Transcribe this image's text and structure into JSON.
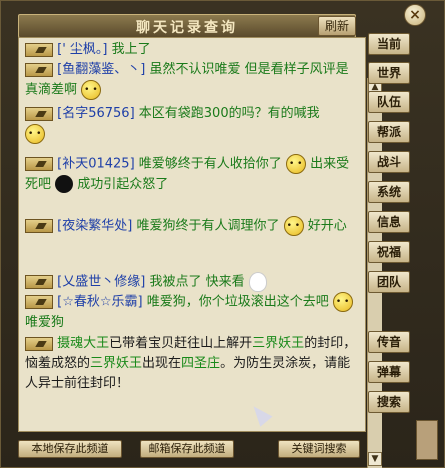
{
  "window": {
    "title": "聊天记录查询",
    "refresh_label": "刷新",
    "close_symbol": "×"
  },
  "messages": [
    {
      "name": "[' 尘枫。]",
      "text": "我上了"
    },
    {
      "name": "[鱼翻藻鉴、丶]",
      "text": "虽然不认识唯爱  但是看样子风评是真滴差啊"
    },
    {
      "name": "[名字56756]",
      "text": "本区有袋跑300的吗？有的喊我"
    },
    {
      "name": "[补天01425]",
      "text": "唯爱够终于有人收拾你了",
      "text2": "出来受死吧",
      "text3": "成功引起众怒了"
    },
    {
      "name": "[夜染繁华处]",
      "text": "唯爱狗终于有人调理你了",
      "text2": "好开心"
    },
    {
      "name": "[乂盛世丶修缘]",
      "text": "我被点了  快来看"
    },
    {
      "name": "[☆春秋☆乐霸]",
      "text": "唯爱狗，你个垃圾滚出这个去吧",
      "text2": "唯爱狗"
    },
    {
      "sender": "摄魂大王",
      "p1": "已带着宝贝赶往山上解开",
      "tag1": "三界妖王",
      "p2": "的封印，恼羞成怒的",
      "tag2": "三界妖王",
      "p3": "出现在",
      "place": "四圣庄",
      "p4": "。为防生灵涂炭，请能人异士前往封印！"
    }
  ],
  "sidebar": [
    "当前",
    "世界",
    "队伍",
    "帮派",
    "战斗",
    "系统",
    "信息",
    "祝福",
    "团队",
    "传音",
    "弹幕",
    "搜索"
  ],
  "bottom": {
    "local_save": "本地保存此频道",
    "mail_save": "邮箱保存此频道",
    "keyword_search": "关键词搜索"
  },
  "colors": {
    "name": "#1e3fa8",
    "message": "#1a7a1a",
    "system_gold": "#b08800",
    "parchment": "#e9e2c9"
  }
}
